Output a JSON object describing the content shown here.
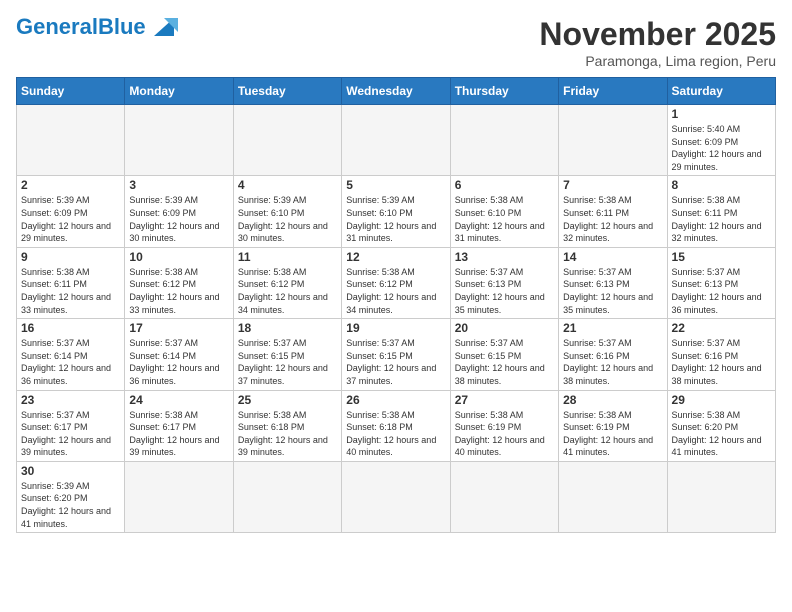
{
  "header": {
    "logo_general": "General",
    "logo_blue": "Blue",
    "month_title": "November 2025",
    "subtitle": "Paramonga, Lima region, Peru"
  },
  "days_of_week": [
    "Sunday",
    "Monday",
    "Tuesday",
    "Wednesday",
    "Thursday",
    "Friday",
    "Saturday"
  ],
  "weeks": [
    [
      {
        "day": "",
        "info": ""
      },
      {
        "day": "",
        "info": ""
      },
      {
        "day": "",
        "info": ""
      },
      {
        "day": "",
        "info": ""
      },
      {
        "day": "",
        "info": ""
      },
      {
        "day": "",
        "info": ""
      },
      {
        "day": "1",
        "info": "Sunrise: 5:40 AM\nSunset: 6:09 PM\nDaylight: 12 hours and 29 minutes."
      }
    ],
    [
      {
        "day": "2",
        "info": "Sunrise: 5:39 AM\nSunset: 6:09 PM\nDaylight: 12 hours and 29 minutes."
      },
      {
        "day": "3",
        "info": "Sunrise: 5:39 AM\nSunset: 6:09 PM\nDaylight: 12 hours and 30 minutes."
      },
      {
        "day": "4",
        "info": "Sunrise: 5:39 AM\nSunset: 6:10 PM\nDaylight: 12 hours and 30 minutes."
      },
      {
        "day": "5",
        "info": "Sunrise: 5:39 AM\nSunset: 6:10 PM\nDaylight: 12 hours and 31 minutes."
      },
      {
        "day": "6",
        "info": "Sunrise: 5:38 AM\nSunset: 6:10 PM\nDaylight: 12 hours and 31 minutes."
      },
      {
        "day": "7",
        "info": "Sunrise: 5:38 AM\nSunset: 6:11 PM\nDaylight: 12 hours and 32 minutes."
      },
      {
        "day": "8",
        "info": "Sunrise: 5:38 AM\nSunset: 6:11 PM\nDaylight: 12 hours and 32 minutes."
      }
    ],
    [
      {
        "day": "9",
        "info": "Sunrise: 5:38 AM\nSunset: 6:11 PM\nDaylight: 12 hours and 33 minutes."
      },
      {
        "day": "10",
        "info": "Sunrise: 5:38 AM\nSunset: 6:12 PM\nDaylight: 12 hours and 33 minutes."
      },
      {
        "day": "11",
        "info": "Sunrise: 5:38 AM\nSunset: 6:12 PM\nDaylight: 12 hours and 34 minutes."
      },
      {
        "day": "12",
        "info": "Sunrise: 5:38 AM\nSunset: 6:12 PM\nDaylight: 12 hours and 34 minutes."
      },
      {
        "day": "13",
        "info": "Sunrise: 5:37 AM\nSunset: 6:13 PM\nDaylight: 12 hours and 35 minutes."
      },
      {
        "day": "14",
        "info": "Sunrise: 5:37 AM\nSunset: 6:13 PM\nDaylight: 12 hours and 35 minutes."
      },
      {
        "day": "15",
        "info": "Sunrise: 5:37 AM\nSunset: 6:13 PM\nDaylight: 12 hours and 36 minutes."
      }
    ],
    [
      {
        "day": "16",
        "info": "Sunrise: 5:37 AM\nSunset: 6:14 PM\nDaylight: 12 hours and 36 minutes."
      },
      {
        "day": "17",
        "info": "Sunrise: 5:37 AM\nSunset: 6:14 PM\nDaylight: 12 hours and 36 minutes."
      },
      {
        "day": "18",
        "info": "Sunrise: 5:37 AM\nSunset: 6:15 PM\nDaylight: 12 hours and 37 minutes."
      },
      {
        "day": "19",
        "info": "Sunrise: 5:37 AM\nSunset: 6:15 PM\nDaylight: 12 hours and 37 minutes."
      },
      {
        "day": "20",
        "info": "Sunrise: 5:37 AM\nSunset: 6:15 PM\nDaylight: 12 hours and 38 minutes."
      },
      {
        "day": "21",
        "info": "Sunrise: 5:37 AM\nSunset: 6:16 PM\nDaylight: 12 hours and 38 minutes."
      },
      {
        "day": "22",
        "info": "Sunrise: 5:37 AM\nSunset: 6:16 PM\nDaylight: 12 hours and 38 minutes."
      }
    ],
    [
      {
        "day": "23",
        "info": "Sunrise: 5:37 AM\nSunset: 6:17 PM\nDaylight: 12 hours and 39 minutes."
      },
      {
        "day": "24",
        "info": "Sunrise: 5:38 AM\nSunset: 6:17 PM\nDaylight: 12 hours and 39 minutes."
      },
      {
        "day": "25",
        "info": "Sunrise: 5:38 AM\nSunset: 6:18 PM\nDaylight: 12 hours and 39 minutes."
      },
      {
        "day": "26",
        "info": "Sunrise: 5:38 AM\nSunset: 6:18 PM\nDaylight: 12 hours and 40 minutes."
      },
      {
        "day": "27",
        "info": "Sunrise: 5:38 AM\nSunset: 6:19 PM\nDaylight: 12 hours and 40 minutes."
      },
      {
        "day": "28",
        "info": "Sunrise: 5:38 AM\nSunset: 6:19 PM\nDaylight: 12 hours and 41 minutes."
      },
      {
        "day": "29",
        "info": "Sunrise: 5:38 AM\nSunset: 6:20 PM\nDaylight: 12 hours and 41 minutes."
      }
    ],
    [
      {
        "day": "30",
        "info": "Sunrise: 5:39 AM\nSunset: 6:20 PM\nDaylight: 12 hours and 41 minutes."
      },
      {
        "day": "",
        "info": ""
      },
      {
        "day": "",
        "info": ""
      },
      {
        "day": "",
        "info": ""
      },
      {
        "day": "",
        "info": ""
      },
      {
        "day": "",
        "info": ""
      },
      {
        "day": "",
        "info": ""
      }
    ]
  ]
}
